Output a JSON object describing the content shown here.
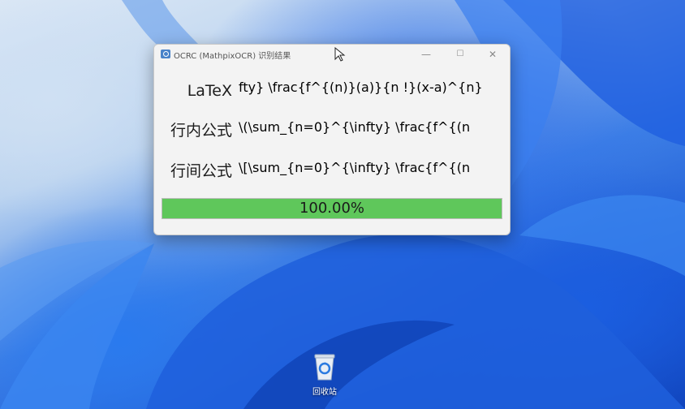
{
  "window": {
    "title": "OCRC (MathpixOCR) 识别结果",
    "minimize_glyph": "—",
    "maximize_glyph": "☐",
    "close_glyph": "✕"
  },
  "fields": [
    {
      "label": "LaTeX",
      "value": "fty} \\frac{f^{(n)}(a)}{n !}(x-a)^{n}"
    },
    {
      "label": "行内公式",
      "value": "\\(\\sum_{n=0}^{\\infty} \\frac{f^{(n"
    },
    {
      "label": "行间公式",
      "value": "\\[\\sum_{n=0}^{\\infty} \\frac{f^{(n"
    }
  ],
  "progress": {
    "text": "100.00%",
    "fraction": 1.0,
    "color": "#5fc75b"
  },
  "desktop": {
    "recycle_bin_label": "回收站"
  },
  "icons": {
    "app": "ocr-app-icon",
    "cursor": "mouse-cursor-icon",
    "recycle": "recycle-bin-icon"
  }
}
